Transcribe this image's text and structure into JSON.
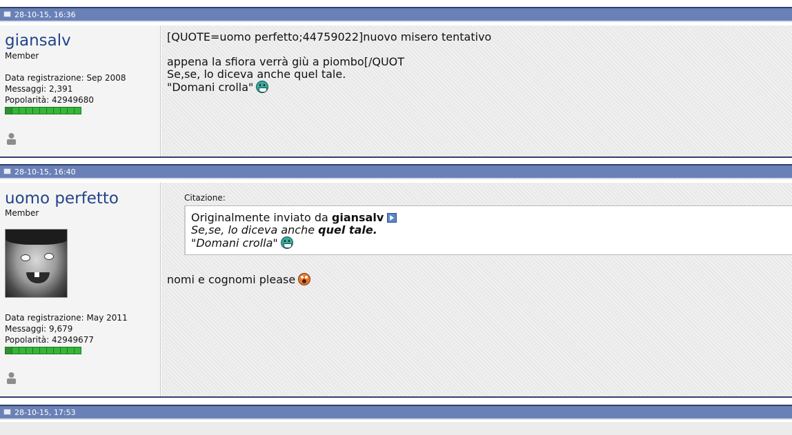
{
  "posts": [
    {
      "date": "28-10-15, 16:36",
      "username": "giansalv",
      "rank": "Member",
      "registration": "Data registrazione: Sep 2008",
      "messages": "Messaggi: 2,391",
      "popularity": "Popolarità: 42949680",
      "reputation_pips": 11,
      "content_lines": [
        "[QUOTE=uomo perfetto;44759022]nuovo misero tentativo",
        "appena la sfiora verrà giù a piombo[/QUOT",
        "Se,se, lo diceva anche quel tale.",
        "\"Domani crolla\""
      ],
      "smiley": "grin-smiley"
    },
    {
      "date": "28-10-15, 16:40",
      "username": "uomo perfetto",
      "rank": "Member",
      "registration": "Data registrazione: May 2011",
      "messages": "Messaggi: 9,679",
      "popularity": "Popolarità: 42949677",
      "reputation_pips": 11,
      "quote": {
        "label": "Citazione:",
        "prefix": "Originalmente inviato da",
        "author": "giansalv",
        "line1_start": "Se,se, lo diceva anche ",
        "line1_bold": "quel tale.",
        "line2": "\"Domani crolla\""
      },
      "content": "nomi e cognomi please",
      "smiley": "shock-smiley"
    },
    {
      "date": "28-10-15, 17:53"
    }
  ],
  "colors": {
    "header_bg": "#6a81b7",
    "username": "#22448a",
    "reputation": "#37b53a"
  }
}
